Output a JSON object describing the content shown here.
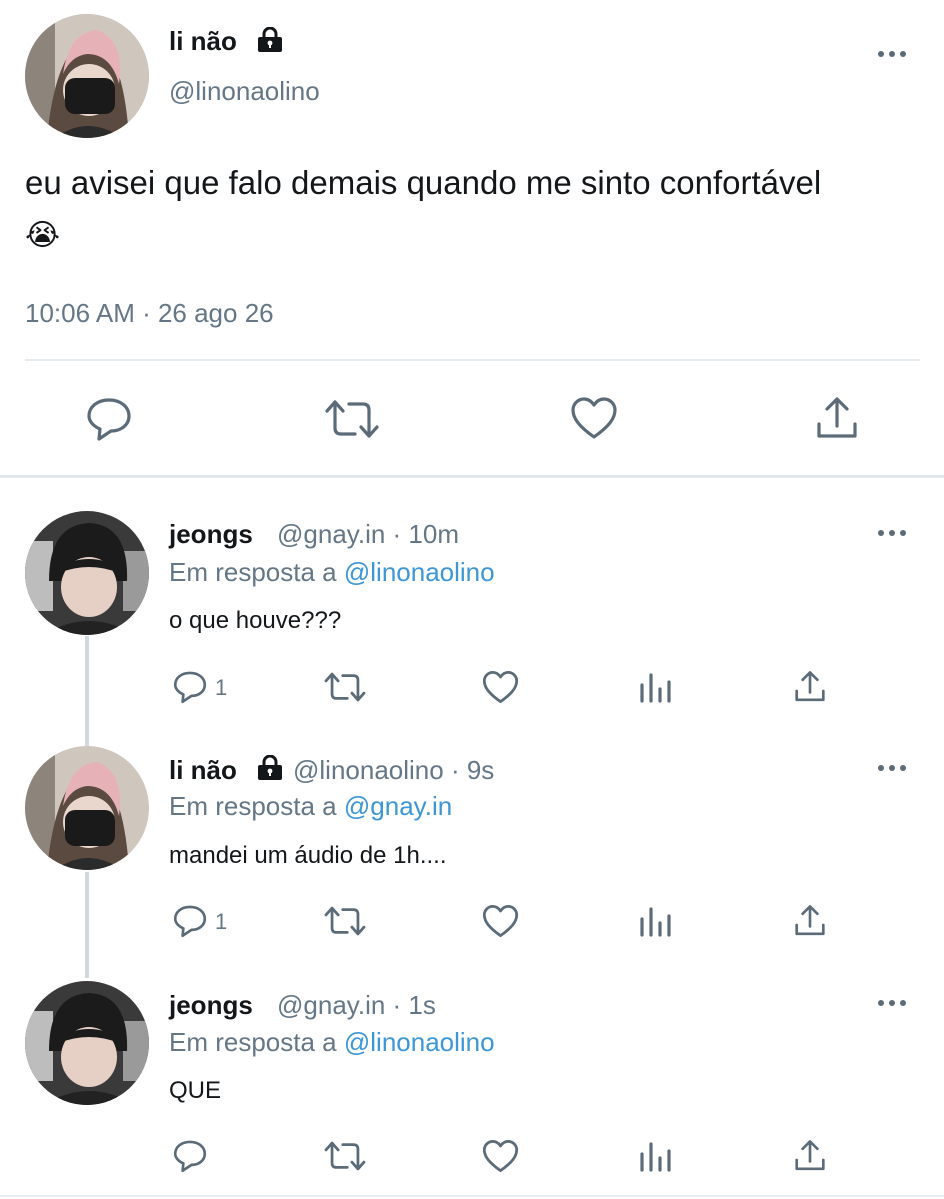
{
  "main_tweet": {
    "display_name": "li não",
    "handle": "@linonaolino",
    "text": "eu avisei que falo demais quando me sinto confortável",
    "emoji": "😭",
    "timestamp": "10:06 AM · 26 ago 26",
    "icons": [
      "reply-icon",
      "retweet-icon",
      "like-icon",
      "share-icon"
    ]
  },
  "replies": [
    {
      "display_name": "jeongs",
      "meta": "@gnay.in · 10m",
      "reply_prefix": "Em resposta a",
      "reply_to": "@linonaolino",
      "text": "o que houve???",
      "reply_count": "1"
    },
    {
      "display_name": "li não",
      "meta": "@linonaolino · 9s",
      "reply_prefix": "Em resposta a",
      "reply_to": "@gnay.in",
      "text": "mandei um áudio de 1h....",
      "reply_count": "1"
    },
    {
      "display_name": "jeongs",
      "meta": "@gnay.in · 1s",
      "reply_prefix": "Em resposta a",
      "reply_to": "@linonaolino",
      "text": "QUE",
      "reply_count": ""
    }
  ],
  "colors": {
    "link": "#3d97d6",
    "secondary_text": "#657786",
    "icon": "#5c6b78",
    "divider": "#e6ecf0"
  }
}
